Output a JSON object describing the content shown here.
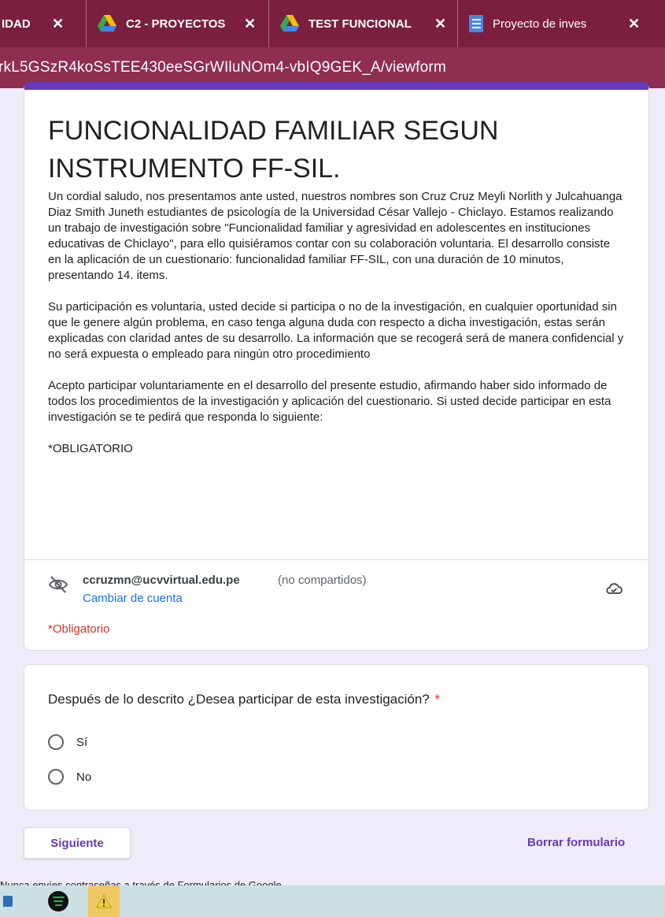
{
  "browser": {
    "tabs": [
      {
        "title": "IDAD",
        "icon": "none"
      },
      {
        "title": "C2 - PROYECTOS",
        "icon": "google-drive-icon"
      },
      {
        "title": "TEST FUNCIONAL",
        "icon": "google-drive-icon"
      },
      {
        "title": "Proyecto de inves",
        "icon": "google-docs-icon"
      }
    ],
    "url": "rkL5GSzR4koSsTEE430eeSGrWIluNOm4-vbIQ9GEK_A/viewform"
  },
  "form": {
    "title": "FUNCIONALIDAD FAMILIAR SEGUN INSTRUMENTO FF-SIL.",
    "description": {
      "p1": "Un cordial saludo, nos presentamos ante usted, nuestros nombres son Cruz Cruz Meyli Norlith y Julcahuanga Diaz Smith Juneth estudiantes de psicología de la Universidad César Vallejo - Chiclayo. Estamos realizando un trabajo de investigación sobre \"Funcionalidad familiar y agresividad en adolescentes en instituciones educativas  de Chiclayo\", para ello quisiéramos contar con su colaboración voluntaria. El desarrollo consiste en la aplicación de un cuestionario: funcionalidad familiar FF-SIL, con una duración de 10 minutos, presentando 14. items.",
      "p2": "Su participación es voluntaria, usted decide si participa o no de la investigación, en cualquier oportunidad sin que le genere algún problema, en caso tenga alguna duda con respecto a dicha investigación, estas serán explicadas con claridad antes de su desarrollo. La información que se recogerá será de manera confidencial y no será expuesta o empleado para ningún otro procedimiento",
      "p3": "Acepto participar voluntariamente en el desarrollo del presente estudio, afirmando haber sido informado de todos los procedimientos de la investigación y aplicación del cuestionario. Si usted decide participar en esta investigación se te pedirá que responda lo siguiente:",
      "p4": "*OBLIGATORIO"
    },
    "account": {
      "email": "ccruzmn@ucvvirtual.edu.pe",
      "note": "(no compartidos)",
      "switch_label": "Cambiar de cuenta"
    },
    "required_note": "*Obligatorio",
    "question": {
      "text": "Después de lo descrito ¿Desea participar de esta investigación?",
      "required_mark": "*",
      "options": [
        "Sí",
        "No"
      ]
    },
    "next_label": "Siguiente",
    "clear_label": "Borrar formulario",
    "password_warning": "Nunca envíes contraseñas a través de Formularios de Google."
  },
  "theme": {
    "accent": "#673ab7",
    "tab_bar": "#7b1f3e",
    "url_bar": "#8e2e51",
    "page_bg": "#f0ebf8",
    "required_red": "#d93025",
    "link_blue": "#1a73e8"
  },
  "taskbar": {
    "apps": [
      "file-explorer-icon",
      "spotify-icon",
      "warning-icon"
    ]
  }
}
